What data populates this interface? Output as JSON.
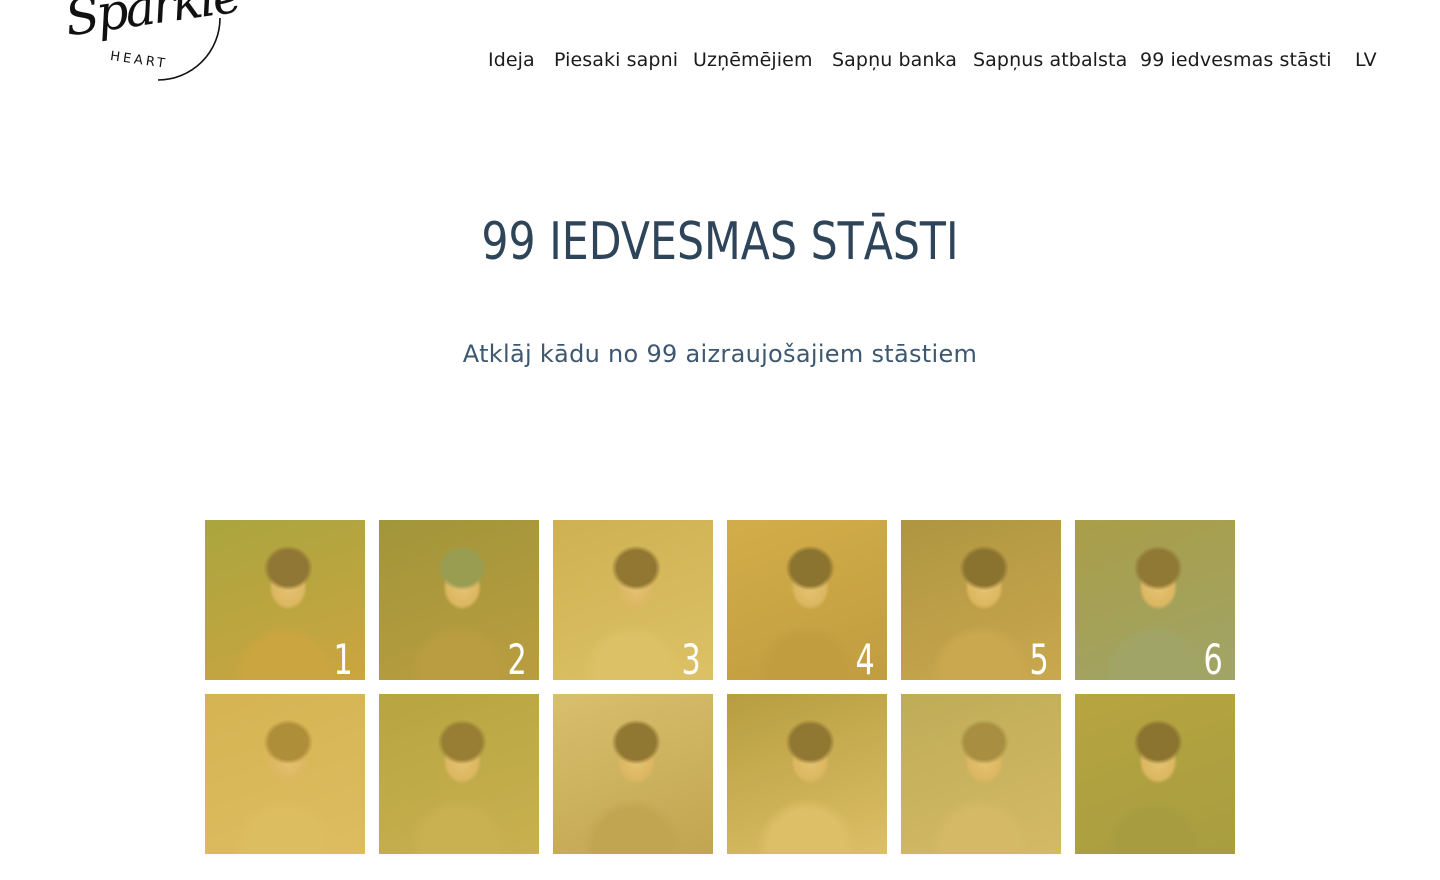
{
  "logo": {
    "script": "Sparkle",
    "sub": "HEART"
  },
  "nav": {
    "items": [
      {
        "label": "Ideja"
      },
      {
        "label": "Piesaki sapni"
      },
      {
        "label": "Uzņēmējiem"
      },
      {
        "label": "Sapņu banka"
      },
      {
        "label": "Sapņus atbalsta"
      },
      {
        "label": "99 iedvesmas stāsti"
      }
    ],
    "lang": "LV"
  },
  "hero": {
    "title": "99 IEDVESMAS STĀSTI",
    "subtitle": "Atklāj kādu no 99 aizraujošajiem stāstiem"
  },
  "stories": [
    {
      "number": "1",
      "palette": [
        "#6f8a36",
        "#b48a3a",
        "#3a2a22"
      ]
    },
    {
      "number": "2",
      "palette": [
        "#5f6a2c",
        "#8f7a3a",
        "#4b7a5e"
      ]
    },
    {
      "number": "3",
      "palette": [
        "#b8a360",
        "#d9c488",
        "#3b2a1c"
      ]
    },
    {
      "number": "4",
      "palette": [
        "#c49a4a",
        "#a07a3a",
        "#2e2418"
      ]
    },
    {
      "number": "5",
      "palette": [
        "#7a6a3a",
        "#b09058",
        "#2b2216"
      ]
    },
    {
      "number": "6",
      "palette": [
        "#6e7a4a",
        "#5a8a8a",
        "#3a2e22"
      ]
    },
    {
      "number": "",
      "palette": [
        "#c8a860",
        "#d8bc7a",
        "#7a5a2a"
      ]
    },
    {
      "number": "",
      "palette": [
        "#8a8a3a",
        "#b0a25a",
        "#4a3a22"
      ]
    },
    {
      "number": "",
      "palette": [
        "#cfc098",
        "#a08a5a",
        "#3a2a1c"
      ]
    },
    {
      "number": "",
      "palette": [
        "#8a7a3a",
        "#d8c088",
        "#3a2a1c"
      ]
    },
    {
      "number": "",
      "palette": [
        "#9a9a6a",
        "#c8b488",
        "#6a5a3a"
      ]
    },
    {
      "number": "",
      "palette": [
        "#8a8a3a",
        "#6a7a3a",
        "#2e2418"
      ]
    }
  ],
  "colors": {
    "title": "#2d4459",
    "subtitle": "#3d5870",
    "tint": "#e0be46"
  }
}
